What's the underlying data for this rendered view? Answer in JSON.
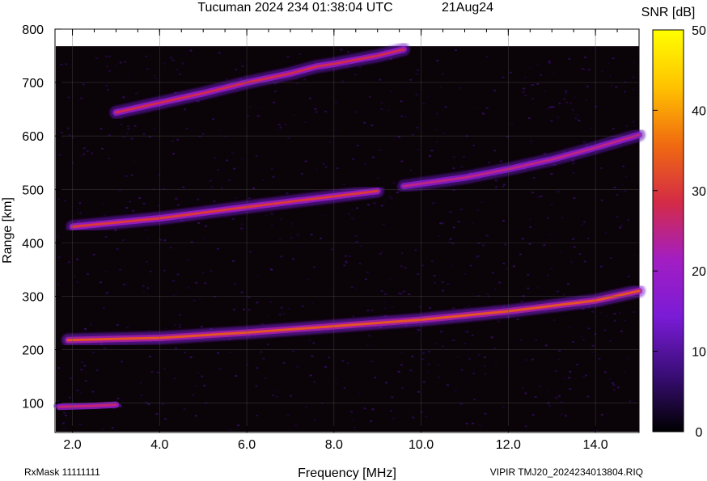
{
  "chart_data": {
    "type": "heatmap",
    "title": "Tucuman 2024 234 01:38:04 UTC",
    "date_label": "21Aug24",
    "xlabel": "Frequency [MHz]",
    "ylabel": "Range [km]",
    "xlim": [
      1.6,
      15.0
    ],
    "ylim": [
      45,
      800
    ],
    "x_ticks": [
      "2.0",
      "4.0",
      "6.0",
      "8.0",
      "10.0",
      "12.0",
      "14.0"
    ],
    "x_tick_values": [
      2,
      4,
      6,
      8,
      10,
      12,
      14
    ],
    "y_ticks": [
      "100",
      "200",
      "300",
      "400",
      "500",
      "600",
      "700",
      "800"
    ],
    "y_tick_values": [
      100,
      200,
      300,
      400,
      500,
      600,
      700,
      800
    ],
    "colorbar": {
      "label": "SNR [dB]",
      "range": [
        0,
        50
      ],
      "ticks": [
        "0",
        "10",
        "20",
        "30",
        "40",
        "50"
      ],
      "tick_values": [
        0,
        10,
        20,
        30,
        40,
        50
      ],
      "colors": [
        "#000000",
        "#3a0d78",
        "#7a1bd6",
        "#a31ec3",
        "#d42b46",
        "#f06a10",
        "#ffc200",
        "#ffff00"
      ]
    },
    "grid": true,
    "traces": [
      {
        "name": "",
        "points": [
          [
            1.7,
            93
          ],
          [
            2.5,
            95
          ],
          [
            3.0,
            97
          ]
        ],
        "snr": 26
      },
      {
        "name": "",
        "points": [
          [
            1.9,
            218
          ],
          [
            4.0,
            222
          ],
          [
            6.0,
            232
          ],
          [
            8.0,
            244
          ],
          [
            10.0,
            256
          ],
          [
            12.0,
            272
          ],
          [
            14.0,
            292
          ],
          [
            15.0,
            310
          ]
        ],
        "snr": 33
      },
      {
        "name": "",
        "points": [
          [
            2.0,
            430
          ],
          [
            4.0,
            446
          ],
          [
            6.0,
            467
          ],
          [
            8.0,
            487
          ],
          [
            9.0,
            497
          ]
        ],
        "snr": 30
      },
      {
        "name": "",
        "points": [
          [
            9.6,
            506
          ],
          [
            11.0,
            522
          ],
          [
            12.0,
            538
          ],
          [
            13.0,
            556
          ],
          [
            14.0,
            578
          ],
          [
            15.0,
            602
          ]
        ],
        "snr": 25
      },
      {
        "name": "",
        "points": [
          [
            3.0,
            644
          ],
          [
            4.0,
            662
          ],
          [
            5.0,
            680
          ],
          [
            6.0,
            700
          ],
          [
            7.0,
            717
          ],
          [
            7.6,
            730
          ],
          [
            8.0,
            735
          ],
          [
            9.0,
            750
          ],
          [
            9.6,
            762
          ]
        ],
        "snr": 28
      }
    ]
  },
  "footer": {
    "left": "RxMask 11111111",
    "right": "VIPIR  TMJ20_2024234013804.RIQ"
  }
}
